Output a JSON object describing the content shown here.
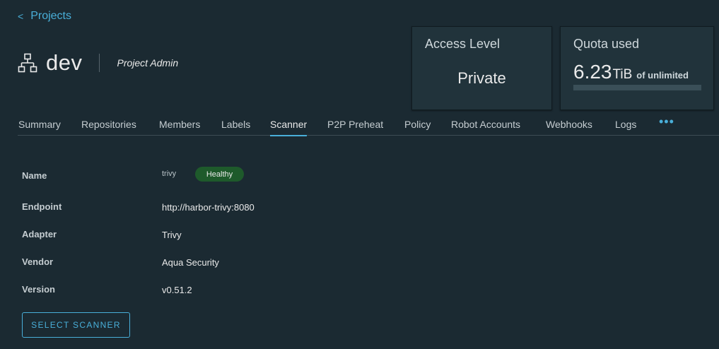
{
  "nav": {
    "back_chevron": "<",
    "back_label": "Projects"
  },
  "project": {
    "icon": "project-tree-icon",
    "name": "dev",
    "role": "Project Admin"
  },
  "access_card": {
    "title": "Access Level",
    "value": "Private"
  },
  "quota_card": {
    "title": "Quota used",
    "number": "6.23",
    "unit": "TiB",
    "suffix": "of unlimited",
    "fill_fraction": 0
  },
  "tabs": [
    {
      "label": "Summary"
    },
    {
      "label": "Repositories"
    },
    {
      "label": "Members"
    },
    {
      "label": "Labels"
    },
    {
      "label": "Scanner",
      "active": true
    },
    {
      "label": "P2P Preheat"
    },
    {
      "label": "Policy"
    },
    {
      "label": "Robot Accounts"
    },
    {
      "label": "Webhooks"
    },
    {
      "label": "Logs"
    }
  ],
  "more_tabs": "•••",
  "scanner": {
    "name_label": "Name",
    "name_value": "trivy",
    "status": "Healthy",
    "endpoint_label": "Endpoint",
    "endpoint_value": "http://harbor-trivy:8080",
    "adapter_label": "Adapter",
    "adapter_value": "Trivy",
    "vendor_label": "Vendor",
    "vendor_value": "Aqua Security",
    "version_label": "Version",
    "version_value": "v0.51.2"
  },
  "select_button": "SELECT SCANNER",
  "colors": {
    "accent": "#49afd9",
    "background": "#1b2a32",
    "healthy": "#1e5a2b"
  }
}
